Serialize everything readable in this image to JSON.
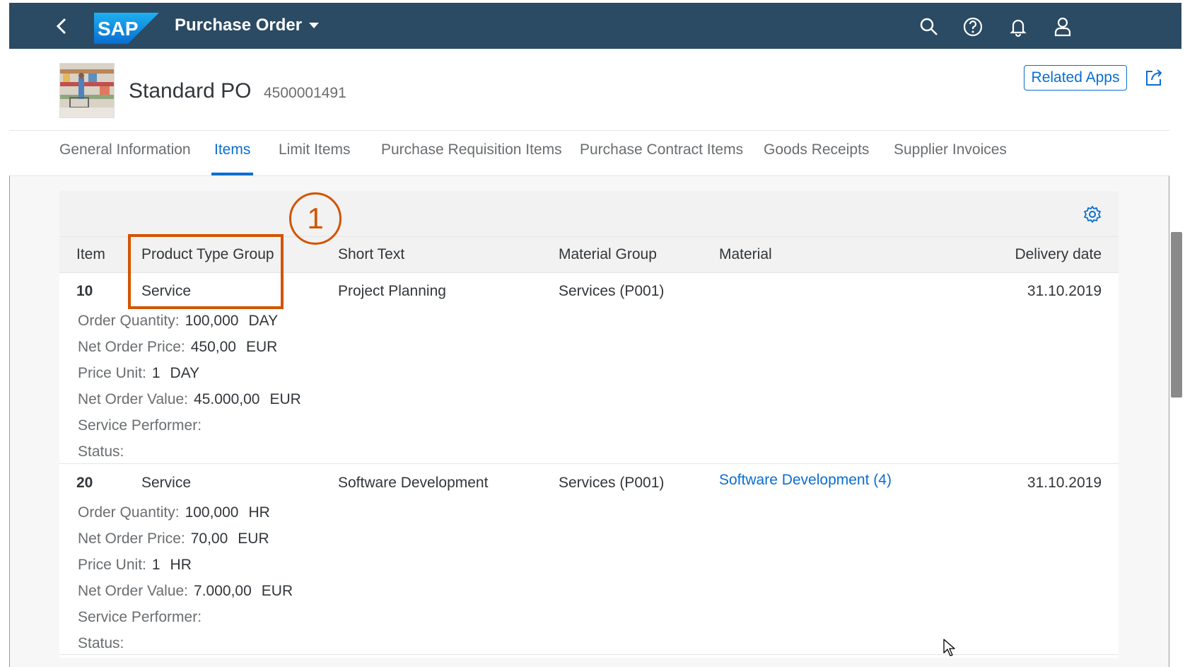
{
  "shell": {
    "logo_text": "SAP",
    "app_title": "Purchase Order",
    "icons": [
      "back-icon",
      "search-icon",
      "help-icon",
      "notifications-icon",
      "user-icon"
    ]
  },
  "header": {
    "title": "Standard PO",
    "number": "4500001491",
    "related_apps": "Related Apps",
    "share_icon": "share-icon"
  },
  "tabs": [
    {
      "label": "General Information",
      "active": false
    },
    {
      "label": "Items",
      "active": true
    },
    {
      "label": "Limit Items",
      "active": false
    },
    {
      "label": "Purchase Requisition Items",
      "active": false
    },
    {
      "label": "Purchase Contract Items",
      "active": false
    },
    {
      "label": "Goods Receipts",
      "active": false
    },
    {
      "label": "Supplier Invoices",
      "active": false
    }
  ],
  "table": {
    "columns": [
      "Item",
      "Product Type Group",
      "Short Text",
      "Material Group",
      "Material",
      "Delivery date"
    ],
    "rows": [
      {
        "item": "10",
        "product_type_group": "Service",
        "short_text": "Project Planning",
        "material_group": "Services (P001)",
        "material": "",
        "delivery_date": "31.10.2019",
        "attributes": {
          "order_quantity": {
            "label": "Order Quantity:",
            "value": "100,000",
            "unit": "DAY"
          },
          "net_order_price": {
            "label": "Net Order Price:",
            "value": "450,00",
            "unit": "EUR"
          },
          "price_unit": {
            "label": "Price Unit:",
            "value": "1",
            "unit": "DAY"
          },
          "net_order_value": {
            "label": "Net Order Value:",
            "value": "45.000,00",
            "unit": "EUR"
          },
          "service_performer": {
            "label": "Service Performer:",
            "value": ""
          },
          "status": {
            "label": "Status:",
            "value": ""
          }
        }
      },
      {
        "item": "20",
        "product_type_group": "Service",
        "short_text": "Software Development",
        "material_group": "Services (P001)",
        "material": "Software Development (4)",
        "delivery_date": "31.10.2019",
        "attributes": {
          "order_quantity": {
            "label": "Order Quantity:",
            "value": "100,000",
            "unit": "HR"
          },
          "net_order_price": {
            "label": "Net Order Price:",
            "value": "70,00",
            "unit": "EUR"
          },
          "price_unit": {
            "label": "Price Unit:",
            "value": "1",
            "unit": "HR"
          },
          "net_order_value": {
            "label": "Net Order Value:",
            "value": "7.000,00",
            "unit": "EUR"
          },
          "service_performer": {
            "label": "Service Performer:",
            "value": ""
          },
          "status": {
            "label": "Status:",
            "value": ""
          }
        }
      }
    ]
  },
  "callout": {
    "number": "1",
    "color": "#d35400"
  },
  "colors": {
    "shell_bg": "#2b4a63",
    "accent": "#0a6ed1",
    "callout": "#d35400"
  }
}
